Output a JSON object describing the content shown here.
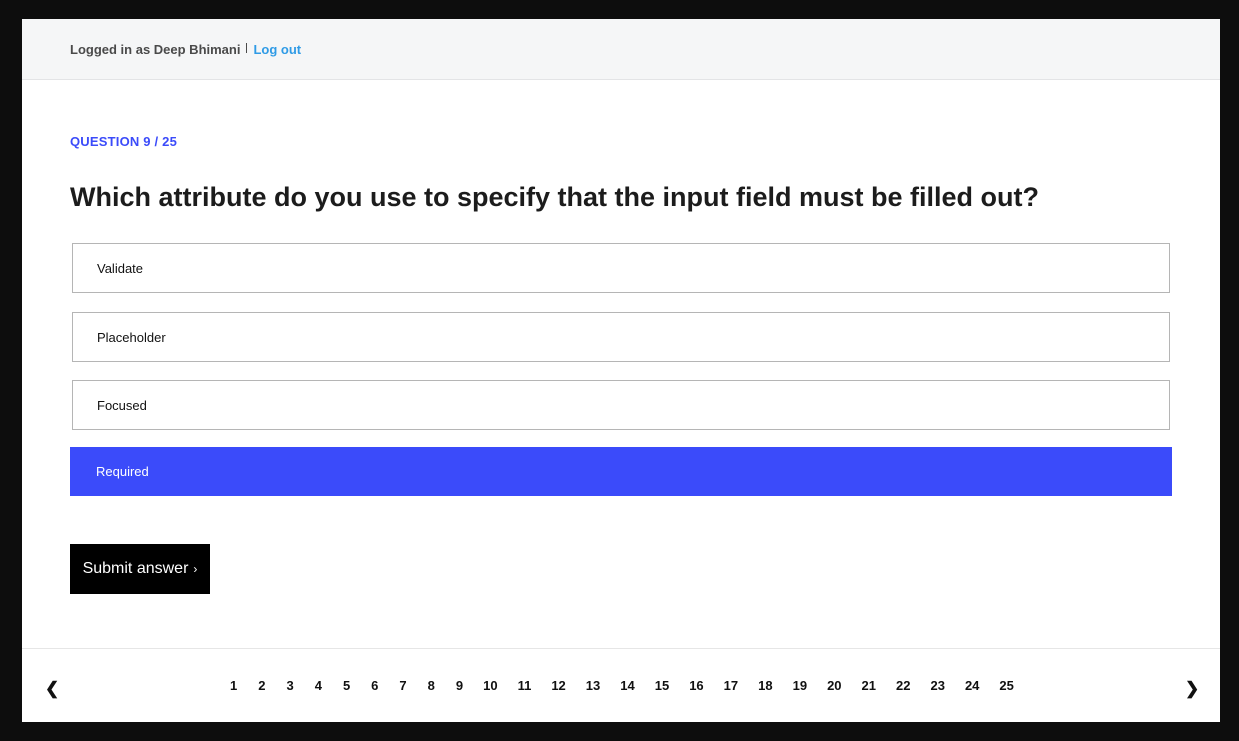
{
  "header": {
    "logged_in_text": "Logged in as Deep Bhimani",
    "logout_label": "Log out"
  },
  "quiz": {
    "progress_label": "QUESTION 9 / 25",
    "question": "Which attribute do you use to specify that the input field must be filled out?",
    "options": [
      {
        "label": "Validate",
        "selected": false
      },
      {
        "label": "Placeholder",
        "selected": false
      },
      {
        "label": "Focused",
        "selected": false
      },
      {
        "label": "Required",
        "selected": true
      }
    ],
    "submit_label": "Submit answer",
    "submit_icon": "›"
  },
  "pagination": {
    "prev_icon": "❮",
    "next_icon": "❯",
    "pages": [
      "1",
      "2",
      "3",
      "4",
      "5",
      "6",
      "7",
      "8",
      "9",
      "10",
      "11",
      "12",
      "13",
      "14",
      "15",
      "16",
      "17",
      "18",
      "19",
      "20",
      "21",
      "22",
      "23",
      "24",
      "25"
    ]
  },
  "colors": {
    "accent": "#3b4bfa",
    "link": "#2f9be6",
    "button_bg": "#000000"
  }
}
